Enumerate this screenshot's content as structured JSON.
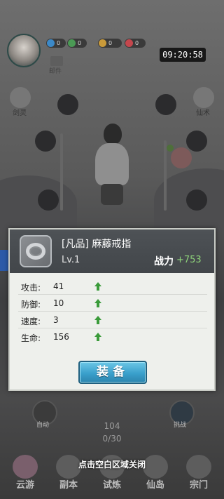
{
  "status": {
    "clock": "09:20:58"
  },
  "resources": [
    {
      "icon": "spirit-orb-icon",
      "value": "0",
      "color": "#3c89c8"
    },
    {
      "icon": "leaf-icon",
      "value": "0",
      "color": "#4b9a55"
    },
    {
      "icon": "gold-ingot-icon",
      "value": "0",
      "color": "#c99a3a"
    },
    {
      "icon": "gem-icon",
      "value": "0",
      "color": "#c4474d"
    }
  ],
  "topbar": {
    "mail_label": "邮件"
  },
  "side_labels": {
    "left": "剑灵",
    "right": "仙术"
  },
  "item": {
    "name": "[凡品] 麻藤戒指",
    "level": "Lv.1",
    "power_label": "战力",
    "power_value": "+753",
    "icon": "ring-icon"
  },
  "stats": [
    {
      "name": "攻击:",
      "value": "41",
      "trend": "up"
    },
    {
      "name": "防御:",
      "value": "10",
      "trend": "up"
    },
    {
      "name": "速度:",
      "value": "3",
      "trend": "up"
    },
    {
      "name": "生命:",
      "value": "156",
      "trend": "up"
    }
  ],
  "equip_button": "装备",
  "battle": {
    "auto_label": "自动",
    "challenge_label": "挑战",
    "stage": "104",
    "progress": "0/30"
  },
  "close_tip": "点击空白区域关闭",
  "nav": [
    {
      "label": "云游",
      "icon": "cloud-travel-icon"
    },
    {
      "label": "副本",
      "icon": "dungeon-icon"
    },
    {
      "label": "试炼",
      "icon": "trial-icon"
    },
    {
      "label": "仙岛",
      "icon": "immortal-island-icon"
    },
    {
      "label": "宗门",
      "icon": "sect-icon"
    }
  ],
  "colors": {
    "power_value": "#8ed37a",
    "stat_up_arrow": "#3a9b3a",
    "equip_button": "#3aa0cc"
  }
}
